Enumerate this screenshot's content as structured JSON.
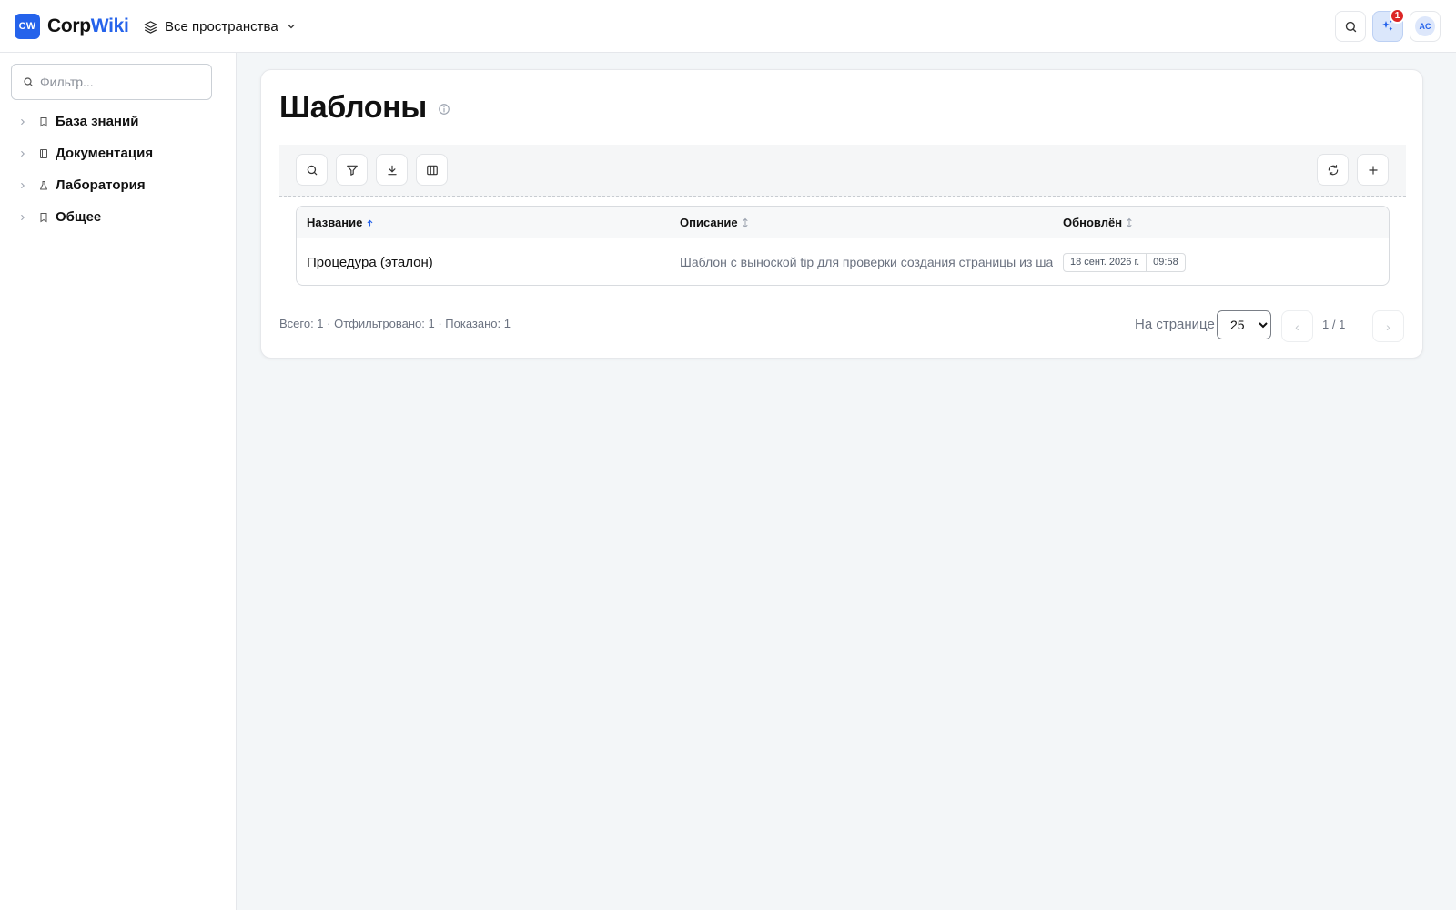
{
  "header": {
    "logo_badge": "CW",
    "logo_text_part1": "Corp",
    "logo_text_part2": "Wiki",
    "space_selector_label": "Все пространства",
    "notification_count": "1",
    "avatar_initials": "AC"
  },
  "sidebar": {
    "filter_placeholder": "Фильтр...",
    "items": [
      {
        "label": "База знаний",
        "icon": "book-icon"
      },
      {
        "label": "Документация",
        "icon": "notebook-icon"
      },
      {
        "label": "Лаборатория",
        "icon": "flask-icon"
      },
      {
        "label": "Общее",
        "icon": "book-icon"
      }
    ]
  },
  "main": {
    "title": "Шаблоны",
    "table": {
      "columns": [
        {
          "label": "Название",
          "sort": "asc"
        },
        {
          "label": "Описание",
          "sort": "none"
        },
        {
          "label": "Обновлён",
          "sort": "none"
        }
      ],
      "rows": [
        {
          "name": "Процедура (эталон)",
          "description": "Шаблон с выноской tip для проверки создания страницы из шаблона",
          "date": "18 сент. 2026 г.",
          "time": "09:58"
        }
      ]
    },
    "footer": {
      "counts": "Всего: 1 · Отфильтровано: 1 · Показано: 1",
      "per_page_label": "На странице",
      "per_page_value": "25",
      "prev": "‹",
      "next": "›",
      "page_indicator": "1 / 1"
    }
  },
  "colors": {
    "accent": "#2563eb",
    "badge": "#dc2626",
    "background": "#f3f6f8"
  }
}
